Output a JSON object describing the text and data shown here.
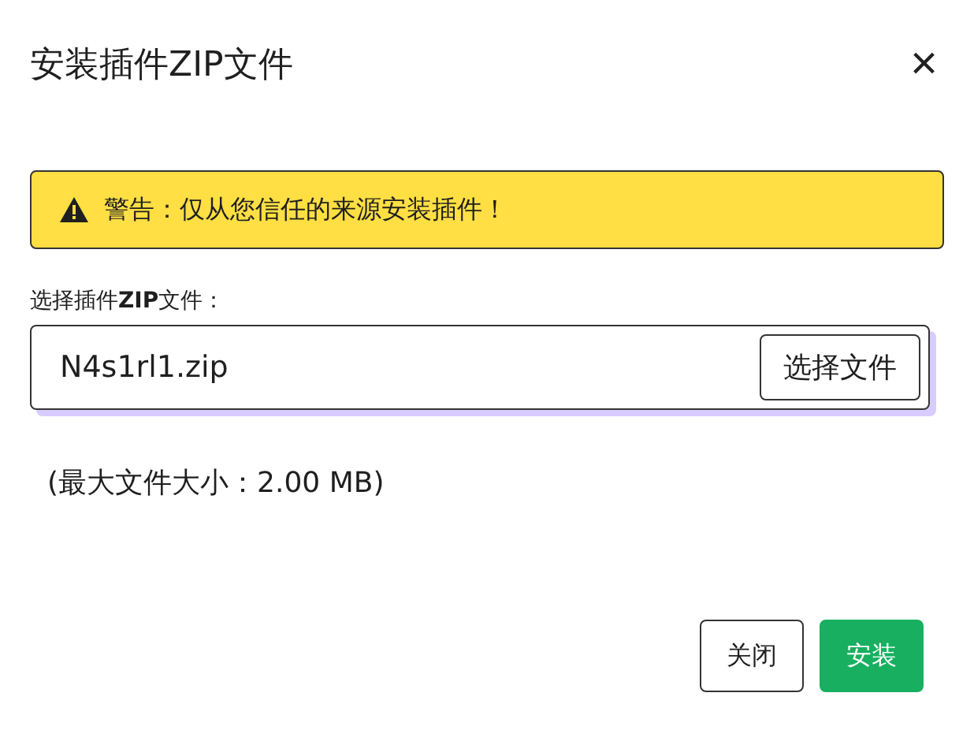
{
  "dialog": {
    "title": "安装插件ZIP文件",
    "close": "×"
  },
  "warning": {
    "text": "警告：仅从您信任的来源安装插件！"
  },
  "file_field": {
    "label": "选择插件**ZIP**文件：",
    "value": "N4s1rl1.zip",
    "button": "选择文件"
  },
  "hint": "(最大文件大小：2.00 MB)",
  "buttons": [
    {
      "label": "关闭",
      "kind": "secondary"
    },
    {
      "label": "安装",
      "kind": "primary"
    }
  ]
}
